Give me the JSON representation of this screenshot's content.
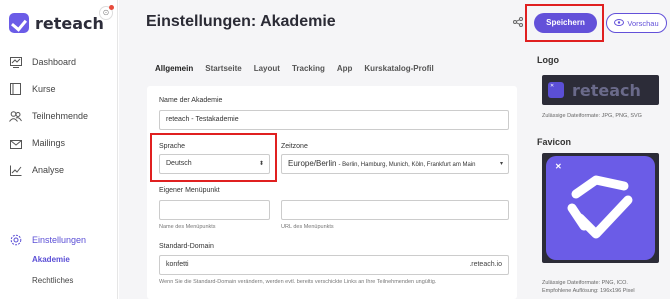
{
  "app": {
    "name": "reteach"
  },
  "sidebar": {
    "items": [
      {
        "label": "Dashboard",
        "icon": "dashboard-icon"
      },
      {
        "label": "Kurse",
        "icon": "book-icon"
      },
      {
        "label": "Teilnehmende",
        "icon": "users-icon"
      },
      {
        "label": "Mailings",
        "icon": "mail-icon"
      },
      {
        "label": "Analyse",
        "icon": "chart-icon"
      }
    ],
    "settings": {
      "label": "Einstellungen",
      "icon": "gear-icon"
    },
    "subitems": [
      {
        "label": "Akademie",
        "active": true
      },
      {
        "label": "Rechtliches",
        "active": false
      }
    ]
  },
  "header": {
    "title": "Einstellungen: Akademie",
    "save_label": "Speichern",
    "preview_label": "Vorschau"
  },
  "tabs": [
    {
      "label": "Allgemein",
      "active": true
    },
    {
      "label": "Startseite",
      "active": false
    },
    {
      "label": "Layout",
      "active": false
    },
    {
      "label": "Tracking",
      "active": false
    },
    {
      "label": "App",
      "active": false
    },
    {
      "label": "Kurskatalog-Profil",
      "active": false
    }
  ],
  "form": {
    "academy_name": {
      "label": "Name der Akademie",
      "value": "reteach - Testakademie"
    },
    "language": {
      "label": "Sprache",
      "value": "Deutsch"
    },
    "timezone": {
      "label": "Zeitzone",
      "value": "Europe/Berlin",
      "detail": "- Berlin, Hamburg, Munich, Köln, Frankfurt am Main"
    },
    "menu_item": {
      "label": "Eigener Menüpunkt",
      "name_hint": "Name des Menüpunkts",
      "url_hint": "URL des Menüpunkts"
    },
    "domain": {
      "label": "Standard-Domain",
      "value": "konfetti",
      "suffix": ".reteach.io",
      "hint": "Wenn Sie die Standard-Domain verändern, werden evtl. bereits verschickte Links an Ihre Teilnehmenden ungültig."
    }
  },
  "right_panel": {
    "logo_title": "Logo",
    "logo_text": "reteach",
    "logo_hint": "Zulässige Dateiformate: JPG, PNG, SVG",
    "favicon_title": "Favicon",
    "favicon_hint_1": "Zulässige Dateiformate: PNG, ICO.",
    "favicon_hint_2": "Empfohlene Auflösung: 196x196 Pixel"
  },
  "colors": {
    "accent": "#6351d9",
    "highlight": "#e02020",
    "dark": "#2c2c38"
  }
}
